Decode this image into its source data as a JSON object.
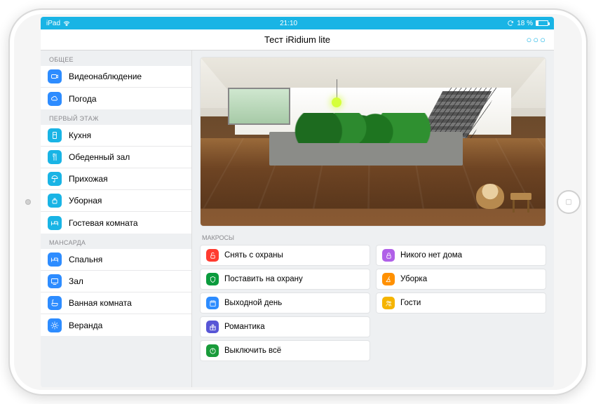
{
  "status": {
    "device": "iPad",
    "time": "21:10",
    "battery_text": "18 %"
  },
  "navbar": {
    "title": "Тест iRidium lite"
  },
  "sidebar": {
    "sections": [
      {
        "header": "ОБЩЕЕ",
        "items": [
          {
            "label": "Видеонаблюдение",
            "icon": "camera",
            "color": "c-blue"
          },
          {
            "label": "Погода",
            "icon": "cloud",
            "color": "c-blue"
          }
        ]
      },
      {
        "header": "ПЕРВЫЙ ЭТАЖ",
        "items": [
          {
            "label": "Кухня",
            "icon": "fridge",
            "color": "c-cyan"
          },
          {
            "label": "Обеденный зал",
            "icon": "fork",
            "color": "c-cyan"
          },
          {
            "label": "Прихожая",
            "icon": "umbrella",
            "color": "c-cyan"
          },
          {
            "label": "Уборная",
            "icon": "soap",
            "color": "c-cyan"
          },
          {
            "label": "Гостевая комната",
            "icon": "bed",
            "color": "c-cyan"
          }
        ]
      },
      {
        "header": "МАНСАРДА",
        "items": [
          {
            "label": "Спальня",
            "icon": "bed",
            "color": "c-blue"
          },
          {
            "label": "Зал",
            "icon": "tv",
            "color": "c-blue"
          },
          {
            "label": "Ванная комната",
            "icon": "bath",
            "color": "c-blue"
          },
          {
            "label": "Веранда",
            "icon": "sun",
            "color": "c-blue"
          }
        ]
      }
    ]
  },
  "macros": {
    "header": "МАКРОСЫ",
    "col1": [
      {
        "label": "Снять с охраны",
        "icon": "lock-open",
        "color": "c-red"
      },
      {
        "label": "Поставить на охрану",
        "icon": "shield",
        "color": "c-darkgreen"
      },
      {
        "label": "Выходной день",
        "icon": "calendar",
        "color": "c-blue"
      },
      {
        "label": "Романтика",
        "icon": "gift",
        "color": "c-indigo"
      },
      {
        "label": "Выключить всё",
        "icon": "power",
        "color": "c-green"
      }
    ],
    "col2": [
      {
        "label": "Никого нет дома",
        "icon": "lock",
        "color": "c-purple"
      },
      {
        "label": "Уборка",
        "icon": "broom",
        "color": "c-orange"
      },
      {
        "label": "Гости",
        "icon": "people",
        "color": "c-amber"
      }
    ]
  }
}
